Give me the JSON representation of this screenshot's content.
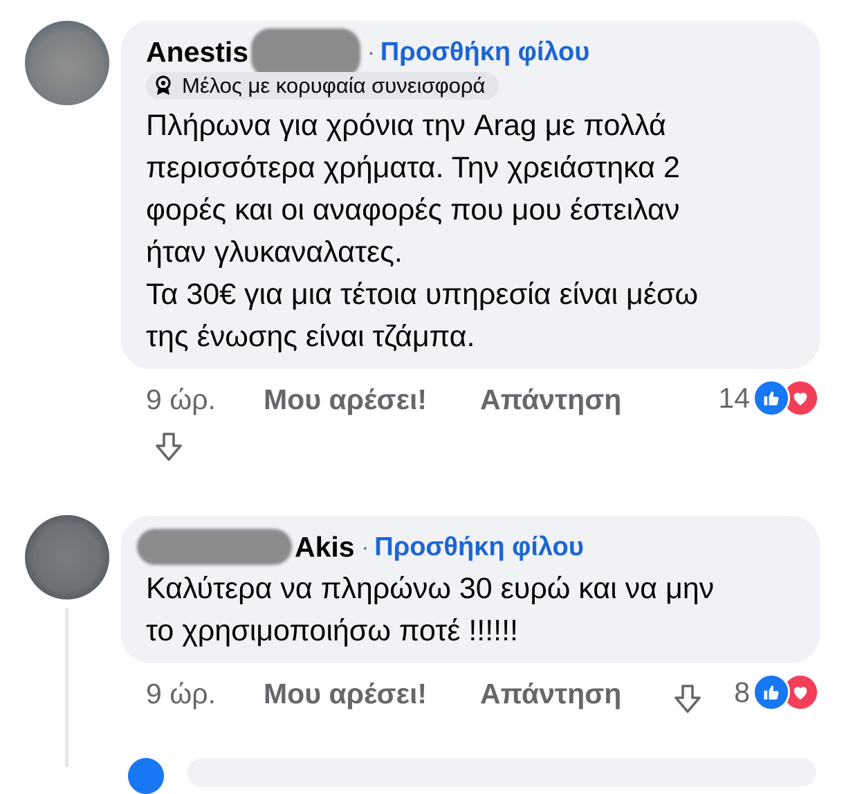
{
  "comments": [
    {
      "author_name": "Anestis",
      "add_friend_label": "Προσθήκη φίλου",
      "badge_label": "Μέλος με κορυφαία συνεισφορά",
      "text": "Πλήρωνα για χρόνια την Arag με πολλά\nπερισσότερα χρήματα. Την χρειάστηκα 2\nφορές και οι αναφορές που μου έστειλαν\nήταν γλυκαναλατες.\nΤα 30€ για μια τέτοια υπηρεσία είναι μέσω\nτης ένωσης είναι τζάμπα.",
      "timestamp": "9 ώρ.",
      "like_label": "Μου αρέσει!",
      "reply_label": "Απάντηση",
      "reaction_count": "14",
      "reactions": [
        "like-icon",
        "love-icon"
      ]
    },
    {
      "author_name": "Akis",
      "add_friend_label": "Προσθήκη φίλου",
      "text": "Καλύτερα να πληρώνω 30 ευρώ και να μην\nτο χρησιμοποιήσω ποτέ !!!!!!",
      "timestamp": "9 ώρ.",
      "like_label": "Μου αρέσει!",
      "reply_label": "Απάντηση",
      "reaction_count": "8",
      "reactions": [
        "like-icon",
        "love-icon"
      ]
    }
  ],
  "colors": {
    "bubble_bg": "#f0f2f5",
    "link_blue": "#1b66d6",
    "secondary_text": "#65676b",
    "like_blue": "#1877f2",
    "love_red": "#f33e58"
  }
}
